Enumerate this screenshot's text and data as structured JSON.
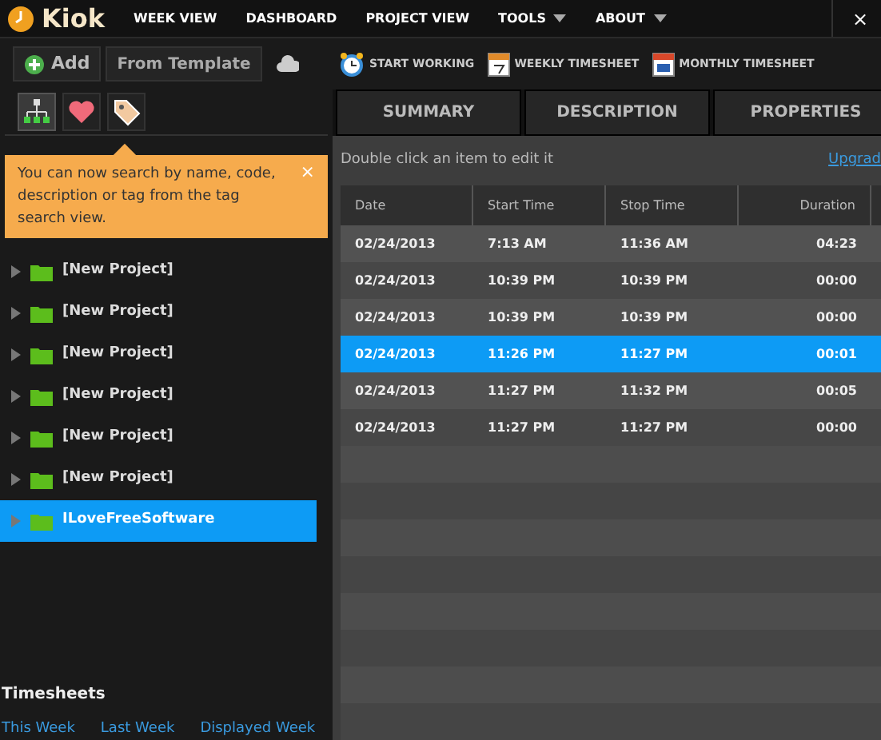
{
  "header": {
    "logo": "Kiok",
    "nav": [
      {
        "label": "WEEK VIEW",
        "dropdown": false
      },
      {
        "label": "DASHBOARD",
        "dropdown": false
      },
      {
        "label": "PROJECT VIEW",
        "dropdown": false
      },
      {
        "label": "TOOLS",
        "dropdown": true
      },
      {
        "label": "ABOUT",
        "dropdown": true
      }
    ],
    "close": "×"
  },
  "toolbar": {
    "add": "Add",
    "template": "From Template",
    "actions": [
      {
        "label": "START WORKING",
        "kind": "clock"
      },
      {
        "label": "WEEKLY TIMESHEET",
        "kind": "week"
      },
      {
        "label": "MONTHLY TIMESHEET",
        "kind": "month"
      }
    ]
  },
  "sidebar": {
    "view_buttons": [
      {
        "kind": "tree",
        "selected": true
      },
      {
        "kind": "heart",
        "selected": false
      },
      {
        "kind": "tag",
        "selected": false
      }
    ],
    "tip": {
      "text": "You can now search by name, code, description or tag from the tag search view.",
      "close": "×"
    },
    "projects": [
      {
        "name": "[New Project]",
        "selected": false
      },
      {
        "name": "[New Project]",
        "selected": false
      },
      {
        "name": "[New Project]",
        "selected": false
      },
      {
        "name": "[New Project]",
        "selected": false
      },
      {
        "name": "[New Project]",
        "selected": false
      },
      {
        "name": "[New Project]",
        "selected": false
      },
      {
        "name": "ILoveFreeSoftware",
        "selected": true
      }
    ],
    "timesheets": {
      "title": "Timesheets",
      "links": [
        "This Week",
        "Last Week",
        "Displayed Week"
      ]
    }
  },
  "tabs": [
    {
      "label": "SUMMARY",
      "selected": false
    },
    {
      "label": "DESCRIPTION",
      "selected": false
    },
    {
      "label": "PROPERTIES",
      "selected": false
    }
  ],
  "hint": "Double click an item to edit it",
  "upgrade": "Upgrad",
  "table": {
    "columns": [
      "Date",
      "Start Time",
      "Stop Time",
      "Duration"
    ],
    "rows": [
      {
        "cells": [
          "02/24/2013",
          "7:13 AM",
          "11:36 AM",
          "04:23"
        ],
        "selected": false
      },
      {
        "cells": [
          "02/24/2013",
          "10:39 PM",
          "10:39 PM",
          "00:00"
        ],
        "selected": false
      },
      {
        "cells": [
          "02/24/2013",
          "10:39 PM",
          "10:39 PM",
          "00:00"
        ],
        "selected": false
      },
      {
        "cells": [
          "02/24/2013",
          "11:26 PM",
          "11:27 PM",
          "00:01"
        ],
        "selected": true
      },
      {
        "cells": [
          "02/24/2013",
          "11:27 PM",
          "11:32 PM",
          "00:05"
        ],
        "selected": false
      },
      {
        "cells": [
          "02/24/2013",
          "11:27 PM",
          "11:27 PM",
          "00:00"
        ],
        "selected": false
      }
    ]
  }
}
